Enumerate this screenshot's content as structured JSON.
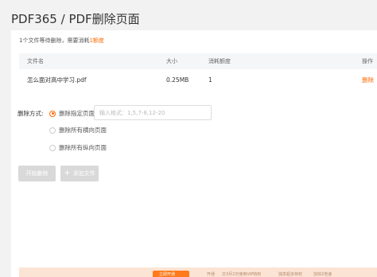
{
  "page": {
    "title": "PDF365 / PDF删除页面"
  },
  "notice": {
    "prefix": "1个文件等待删除，需要消耗",
    "credits": "1额度"
  },
  "table": {
    "headers": {
      "name": "文件名",
      "size": "大小",
      "credits": "消耗额度",
      "action": "操作"
    },
    "rows": [
      {
        "name": "怎么面对高中学习.pdf",
        "size": "0.25MB",
        "credits": "1",
        "action": "删除"
      }
    ]
  },
  "delete_mode": {
    "label": "删除方式:",
    "options": [
      {
        "label": "删除指定页面",
        "selected": true
      },
      {
        "label": "删除所有横向页面",
        "selected": false
      },
      {
        "label": "删除所有纵向页面",
        "selected": false
      }
    ],
    "range_input": {
      "value": "",
      "placeholder": "输入格式：1,5,7-8,12-20"
    }
  },
  "buttons": {
    "start": "开始删除",
    "add_file": "添加文件",
    "add_icon": "+"
  },
  "footer": {
    "button_label": "立即开通",
    "text_1": "开通",
    "text_2": "次3月2日使用VIP特权",
    "text_3": "独享超多特权",
    "text_4": "加快2倍速"
  },
  "colors": {
    "accent": "#ff6a00",
    "disabled": "#d9d9d9",
    "footer_bg": "#fbe4d4"
  }
}
